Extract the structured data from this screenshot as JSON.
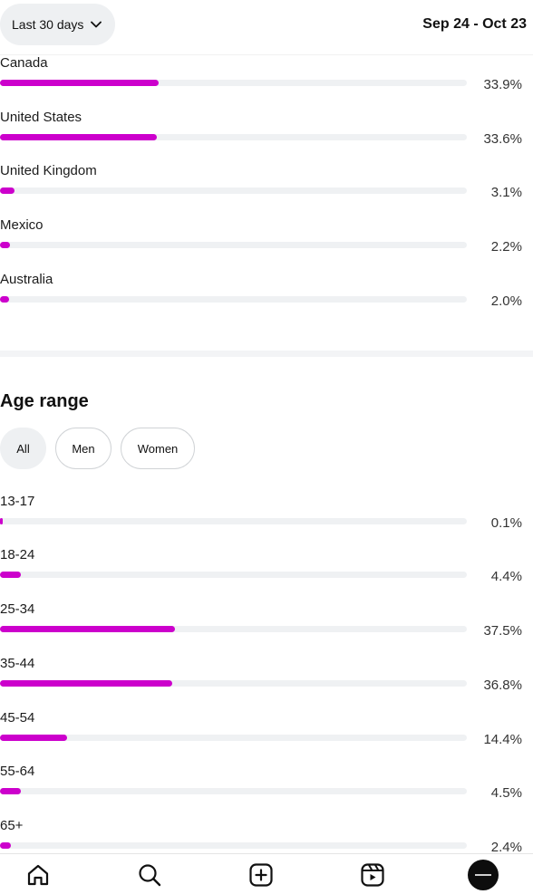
{
  "header": {
    "range_label": "Last 30 days",
    "date_range": "Sep 24 - Oct 23"
  },
  "countries": [
    {
      "name": "Canada",
      "value": "33.9%",
      "fraction": 0.339
    },
    {
      "name": "United States",
      "value": "33.6%",
      "fraction": 0.336
    },
    {
      "name": "United Kingdom",
      "value": "3.1%",
      "fraction": 0.031
    },
    {
      "name": "Mexico",
      "value": "2.2%",
      "fraction": 0.022
    },
    {
      "name": "Australia",
      "value": "2.0%",
      "fraction": 0.02
    }
  ],
  "age_section": {
    "title": "Age range",
    "filters": [
      {
        "label": "All",
        "active": true
      },
      {
        "label": "Men",
        "active": false
      },
      {
        "label": "Women",
        "active": false
      }
    ],
    "rows": [
      {
        "name": "13-17",
        "value": "0.1%",
        "fraction": 0.001
      },
      {
        "name": "18-24",
        "value": "4.4%",
        "fraction": 0.044
      },
      {
        "name": "25-34",
        "value": "37.5%",
        "fraction": 0.375
      },
      {
        "name": "35-44",
        "value": "36.8%",
        "fraction": 0.368
      },
      {
        "name": "45-54",
        "value": "14.4%",
        "fraction": 0.144
      },
      {
        "name": "55-64",
        "value": "4.5%",
        "fraction": 0.045
      },
      {
        "name": "65+",
        "value": "2.4%",
        "fraction": 0.024
      }
    ]
  },
  "colors": {
    "bar_fill": "#cc00cc",
    "bar_track": "#eff1f3"
  },
  "bottom_nav": {
    "icons": [
      "home-icon",
      "search-icon",
      "create-icon",
      "reels-icon",
      "profile-avatar"
    ]
  }
}
